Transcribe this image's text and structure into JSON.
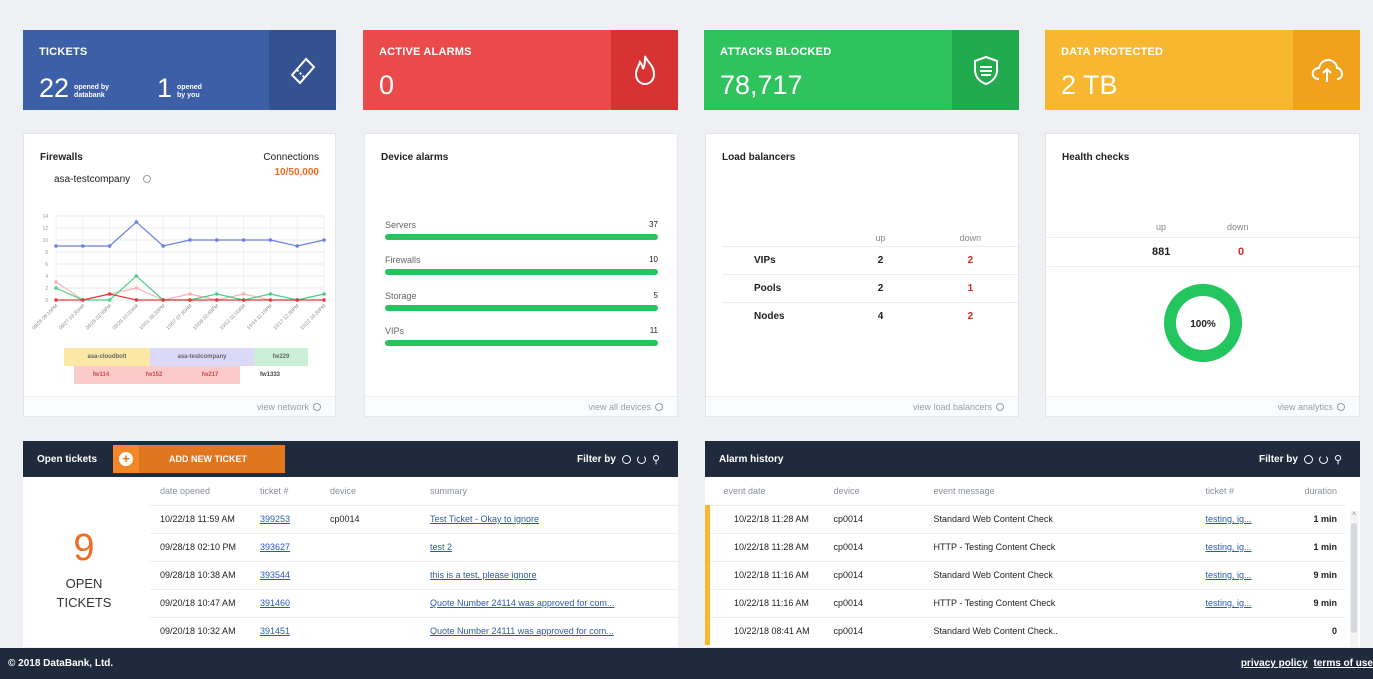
{
  "kpis": {
    "tickets": {
      "label": "TICKETS",
      "opened_databank": "22",
      "opened_databank_label": "opened by databank",
      "opened_you": "1",
      "opened_you_label": "opened by you",
      "color": "#3d5fa8",
      "side_color": "#34528f",
      "icon": "ticket-icon"
    },
    "alarms": {
      "label": "ACTIVE ALARMS",
      "value": "0",
      "color": "#ea4a4a",
      "side_color": "#d83232",
      "icon": "fire-icon"
    },
    "attacks": {
      "label": "ATTACKS BLOCKED",
      "value": "78,717",
      "color": "#2fc35e",
      "side_color": "#22ab4e",
      "icon": "shield-icon"
    },
    "data": {
      "label": "DATA PROTECTED",
      "value": "2 TB",
      "color": "#f7b731",
      "side_color": "#f0a21c",
      "icon": "cloud-upload-icon"
    }
  },
  "firewalls": {
    "title": "Firewalls",
    "device": "asa-testcompany",
    "connections_label": "Connections",
    "connections_value": "10/50,000",
    "footer": "view network",
    "legend_row1": [
      "asa-cloudbolt",
      "asa-testcompany",
      "fw229"
    ],
    "legend_row2": [
      "fw114",
      "fw152",
      "fw217",
      "fw1333"
    ]
  },
  "chart_data": {
    "type": "line",
    "x": [
      "09/28 09:15PM",
      "09/27 03:30AM",
      "09/28 03:55PM",
      "09/29 10:00AM",
      "10/01 06:20PM",
      "10/07 07:30AM",
      "10/09 02:45PM",
      "10/12 01:00AM",
      "10/14 11:15PM",
      "10/17 12:30PM",
      "10/22 03:30PM"
    ],
    "ylim": [
      0,
      14
    ],
    "yticks": [
      "14",
      "12",
      "10",
      "8",
      "6",
      "4",
      "2",
      "0"
    ],
    "grid": true,
    "series": [
      {
        "name": "asa-cloudbolt",
        "color": "#6b7fe0",
        "values": [
          9,
          9,
          9,
          13,
          9,
          10,
          10,
          10,
          10,
          9,
          10
        ]
      },
      {
        "name": "asa-testcompany",
        "color": "#f7b3b3",
        "values": [
          3,
          0,
          1,
          2,
          0,
          1,
          0,
          1,
          0,
          0,
          1
        ]
      },
      {
        "name": "fw229",
        "color": "#4cd08a",
        "values": [
          2,
          0,
          0,
          4,
          0,
          0,
          1,
          0,
          1,
          0,
          1
        ]
      },
      {
        "name": "fw114",
        "color": "#e63a3a",
        "values": [
          0,
          0,
          1,
          0,
          0,
          0,
          0,
          0,
          0,
          0,
          0
        ]
      }
    ]
  },
  "device_alarms": {
    "title": "Device alarms",
    "footer": "view all devices",
    "items": [
      {
        "label": "Servers",
        "value": "37",
        "fill": 1.0
      },
      {
        "label": "Firewalls",
        "value": "10",
        "fill": 1.0
      },
      {
        "label": "Storage",
        "value": "5",
        "fill": 1.0
      },
      {
        "label": "VIPs",
        "value": "11",
        "fill": 1.0
      }
    ]
  },
  "load_balancers": {
    "title": "Load balancers",
    "col_up": "up",
    "col_down": "down",
    "footer": "view load balancers",
    "rows": [
      {
        "label": "VIPs",
        "up": "2",
        "down": "2"
      },
      {
        "label": "Pools",
        "up": "2",
        "down": "1"
      },
      {
        "label": "Nodes",
        "up": "4",
        "down": "2"
      }
    ]
  },
  "health": {
    "title": "Health checks",
    "col_up": "up",
    "col_down": "down",
    "up": "881",
    "down": "0",
    "percent_label": "100%",
    "percent": 1.0,
    "footer": "view analytics"
  },
  "open_tickets": {
    "title": "Open tickets",
    "add_label": "ADD NEW TICKET",
    "filter_label": "Filter by",
    "count": "9",
    "count_label": "OPEN TICKETS",
    "columns": [
      "date opened",
      "ticket #",
      "device",
      "summary"
    ],
    "rows": [
      [
        "10/22/18 11:59 AM",
        "399253",
        "cp0014",
        "Test Ticket - Okay to ignore"
      ],
      [
        "09/28/18 02:10 PM",
        "393627",
        "",
        "test 2"
      ],
      [
        "09/28/18 10:38 AM",
        "393544",
        "",
        "this is a test, please ignore"
      ],
      [
        "09/20/18 10:47 AM",
        "391460",
        "",
        "Quote Number 24114 was approved for com..."
      ],
      [
        "09/20/18 10:32 AM",
        "391451",
        "",
        "Quote Number 24111 was approved for com..."
      ]
    ]
  },
  "alarm_history": {
    "title": "Alarm history",
    "filter_label": "Filter by",
    "columns": [
      "event date",
      "device",
      "event message",
      "ticket #",
      "duration"
    ],
    "rows": [
      [
        "10/22/18 11:28 AM",
        "cp0014",
        "Standard Web Content Check",
        "testing, ig...",
        "1 min"
      ],
      [
        "10/22/18 11:28 AM",
        "cp0014",
        "HTTP - Testing Content Check",
        "testing, ig...",
        "1 min"
      ],
      [
        "10/22/18 11:16 AM",
        "cp0014",
        "Standard Web Content Check",
        "testing, ig...",
        "9 min"
      ],
      [
        "10/22/18 11:16 AM",
        "cp0014",
        "HTTP - Testing Content Check",
        "testing, ig...",
        "9 min"
      ],
      [
        "10/22/18 08:41 AM",
        "cp0014",
        "Standard Web Content Check..",
        "",
        "0"
      ]
    ]
  },
  "footer": {
    "copyright": "© 2018 DataBank, Ltd.",
    "privacy": "privacy policy",
    "terms": "terms of use"
  }
}
